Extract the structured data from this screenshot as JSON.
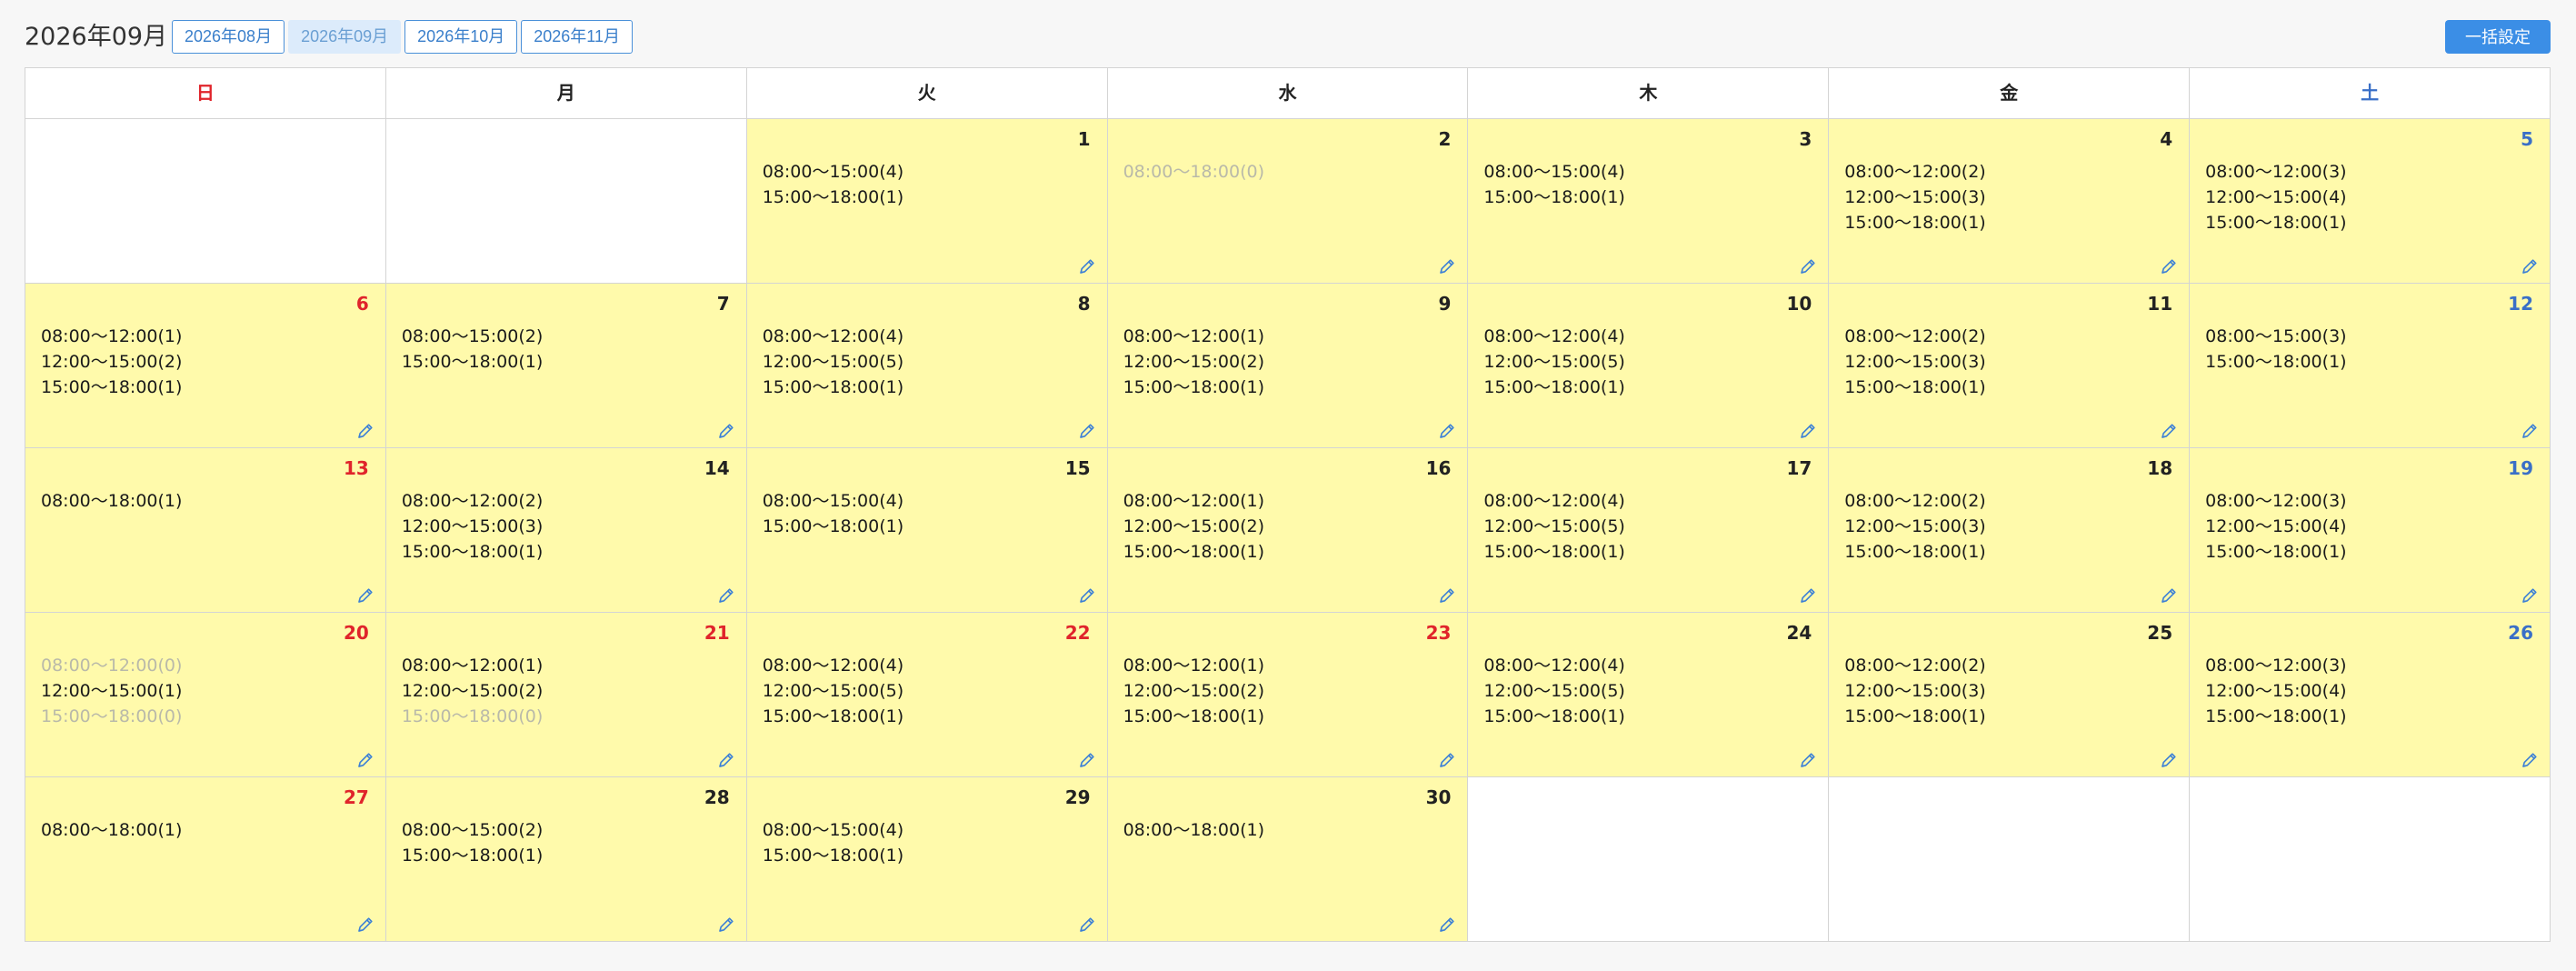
{
  "header": {
    "title": "2026年09月",
    "months": [
      {
        "label": "2026年08月",
        "active": false
      },
      {
        "label": "2026年09月",
        "active": true
      },
      {
        "label": "2026年10月",
        "active": false
      },
      {
        "label": "2026年11月",
        "active": false
      }
    ],
    "bulk_label": "一括設定"
  },
  "weekdays": [
    {
      "label": "日",
      "kind": "sun"
    },
    {
      "label": "月",
      "kind": ""
    },
    {
      "label": "火",
      "kind": ""
    },
    {
      "label": "水",
      "kind": ""
    },
    {
      "label": "木",
      "kind": ""
    },
    {
      "label": "金",
      "kind": ""
    },
    {
      "label": "土",
      "kind": "sat"
    }
  ],
  "colors": {
    "holiday": "#e0242b",
    "saturday": "#3a6fc7",
    "filled": "#fffaab",
    "accent": "#3b8ee6"
  },
  "cells": [
    null,
    null,
    {
      "day": "1",
      "color": "",
      "slots": [
        {
          "text": "08:00〜15:00(4)",
          "off": false
        },
        {
          "text": "15:00〜18:00(1)",
          "off": false
        }
      ]
    },
    {
      "day": "2",
      "color": "",
      "slots": [
        {
          "text": "08:00〜18:00(0)",
          "off": true
        }
      ]
    },
    {
      "day": "3",
      "color": "",
      "slots": [
        {
          "text": "08:00〜15:00(4)",
          "off": false
        },
        {
          "text": "15:00〜18:00(1)",
          "off": false
        }
      ]
    },
    {
      "day": "4",
      "color": "",
      "slots": [
        {
          "text": "08:00〜12:00(2)",
          "off": false
        },
        {
          "text": "12:00〜15:00(3)",
          "off": false
        },
        {
          "text": "15:00〜18:00(1)",
          "off": false
        }
      ]
    },
    {
      "day": "5",
      "color": "blue",
      "slots": [
        {
          "text": "08:00〜12:00(3)",
          "off": false
        },
        {
          "text": "12:00〜15:00(4)",
          "off": false
        },
        {
          "text": "15:00〜18:00(1)",
          "off": false
        }
      ]
    },
    {
      "day": "6",
      "color": "red",
      "slots": [
        {
          "text": "08:00〜12:00(1)",
          "off": false
        },
        {
          "text": "12:00〜15:00(2)",
          "off": false
        },
        {
          "text": "15:00〜18:00(1)",
          "off": false
        }
      ]
    },
    {
      "day": "7",
      "color": "",
      "slots": [
        {
          "text": "08:00〜15:00(2)",
          "off": false
        },
        {
          "text": "15:00〜18:00(1)",
          "off": false
        }
      ]
    },
    {
      "day": "8",
      "color": "",
      "slots": [
        {
          "text": "08:00〜12:00(4)",
          "off": false
        },
        {
          "text": "12:00〜15:00(5)",
          "off": false
        },
        {
          "text": "15:00〜18:00(1)",
          "off": false
        }
      ]
    },
    {
      "day": "9",
      "color": "",
      "slots": [
        {
          "text": "08:00〜12:00(1)",
          "off": false
        },
        {
          "text": "12:00〜15:00(2)",
          "off": false
        },
        {
          "text": "15:00〜18:00(1)",
          "off": false
        }
      ]
    },
    {
      "day": "10",
      "color": "",
      "slots": [
        {
          "text": "08:00〜12:00(4)",
          "off": false
        },
        {
          "text": "12:00〜15:00(5)",
          "off": false
        },
        {
          "text": "15:00〜18:00(1)",
          "off": false
        }
      ]
    },
    {
      "day": "11",
      "color": "",
      "slots": [
        {
          "text": "08:00〜12:00(2)",
          "off": false
        },
        {
          "text": "12:00〜15:00(3)",
          "off": false
        },
        {
          "text": "15:00〜18:00(1)",
          "off": false
        }
      ]
    },
    {
      "day": "12",
      "color": "blue",
      "slots": [
        {
          "text": "08:00〜15:00(3)",
          "off": false
        },
        {
          "text": "15:00〜18:00(1)",
          "off": false
        }
      ]
    },
    {
      "day": "13",
      "color": "red",
      "slots": [
        {
          "text": "08:00〜18:00(1)",
          "off": false
        }
      ]
    },
    {
      "day": "14",
      "color": "",
      "slots": [
        {
          "text": "08:00〜12:00(2)",
          "off": false
        },
        {
          "text": "12:00〜15:00(3)",
          "off": false
        },
        {
          "text": "15:00〜18:00(1)",
          "off": false
        }
      ]
    },
    {
      "day": "15",
      "color": "",
      "slots": [
        {
          "text": "08:00〜15:00(4)",
          "off": false
        },
        {
          "text": "15:00〜18:00(1)",
          "off": false
        }
      ]
    },
    {
      "day": "16",
      "color": "",
      "slots": [
        {
          "text": "08:00〜12:00(1)",
          "off": false
        },
        {
          "text": "12:00〜15:00(2)",
          "off": false
        },
        {
          "text": "15:00〜18:00(1)",
          "off": false
        }
      ]
    },
    {
      "day": "17",
      "color": "",
      "slots": [
        {
          "text": "08:00〜12:00(4)",
          "off": false
        },
        {
          "text": "12:00〜15:00(5)",
          "off": false
        },
        {
          "text": "15:00〜18:00(1)",
          "off": false
        }
      ]
    },
    {
      "day": "18",
      "color": "",
      "slots": [
        {
          "text": "08:00〜12:00(2)",
          "off": false
        },
        {
          "text": "12:00〜15:00(3)",
          "off": false
        },
        {
          "text": "15:00〜18:00(1)",
          "off": false
        }
      ]
    },
    {
      "day": "19",
      "color": "blue",
      "slots": [
        {
          "text": "08:00〜12:00(3)",
          "off": false
        },
        {
          "text": "12:00〜15:00(4)",
          "off": false
        },
        {
          "text": "15:00〜18:00(1)",
          "off": false
        }
      ]
    },
    {
      "day": "20",
      "color": "red",
      "slots": [
        {
          "text": "08:00〜12:00(0)",
          "off": true
        },
        {
          "text": "12:00〜15:00(1)",
          "off": false
        },
        {
          "text": "15:00〜18:00(0)",
          "off": true
        }
      ]
    },
    {
      "day": "21",
      "color": "red",
      "slots": [
        {
          "text": "08:00〜12:00(1)",
          "off": false
        },
        {
          "text": "12:00〜15:00(2)",
          "off": false
        },
        {
          "text": "15:00〜18:00(0)",
          "off": true
        }
      ]
    },
    {
      "day": "22",
      "color": "red",
      "slots": [
        {
          "text": "08:00〜12:00(4)",
          "off": false
        },
        {
          "text": "12:00〜15:00(5)",
          "off": false
        },
        {
          "text": "15:00〜18:00(1)",
          "off": false
        }
      ]
    },
    {
      "day": "23",
      "color": "red",
      "slots": [
        {
          "text": "08:00〜12:00(1)",
          "off": false
        },
        {
          "text": "12:00〜15:00(2)",
          "off": false
        },
        {
          "text": "15:00〜18:00(1)",
          "off": false
        }
      ]
    },
    {
      "day": "24",
      "color": "",
      "slots": [
        {
          "text": "08:00〜12:00(4)",
          "off": false
        },
        {
          "text": "12:00〜15:00(5)",
          "off": false
        },
        {
          "text": "15:00〜18:00(1)",
          "off": false
        }
      ]
    },
    {
      "day": "25",
      "color": "",
      "slots": [
        {
          "text": "08:00〜12:00(2)",
          "off": false
        },
        {
          "text": "12:00〜15:00(3)",
          "off": false
        },
        {
          "text": "15:00〜18:00(1)",
          "off": false
        }
      ]
    },
    {
      "day": "26",
      "color": "blue",
      "slots": [
        {
          "text": "08:00〜12:00(3)",
          "off": false
        },
        {
          "text": "12:00〜15:00(4)",
          "off": false
        },
        {
          "text": "15:00〜18:00(1)",
          "off": false
        }
      ]
    },
    {
      "day": "27",
      "color": "red",
      "slots": [
        {
          "text": "08:00〜18:00(1)",
          "off": false
        }
      ]
    },
    {
      "day": "28",
      "color": "",
      "slots": [
        {
          "text": "08:00〜15:00(2)",
          "off": false
        },
        {
          "text": "15:00〜18:00(1)",
          "off": false
        }
      ]
    },
    {
      "day": "29",
      "color": "",
      "slots": [
        {
          "text": "08:00〜15:00(4)",
          "off": false
        },
        {
          "text": "15:00〜18:00(1)",
          "off": false
        }
      ]
    },
    {
      "day": "30",
      "color": "",
      "slots": [
        {
          "text": "08:00〜18:00(1)",
          "off": false
        }
      ]
    },
    null,
    null,
    null
  ]
}
